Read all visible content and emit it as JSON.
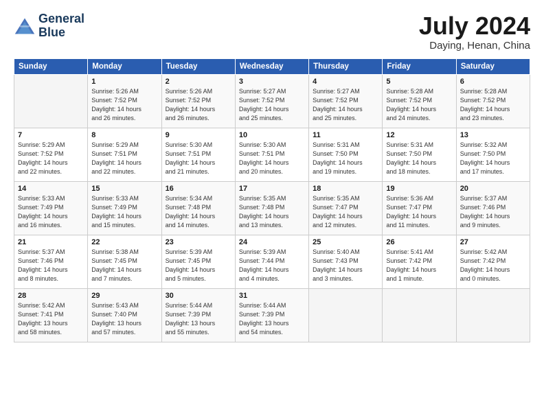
{
  "logo": {
    "line1": "General",
    "line2": "Blue"
  },
  "title": "July 2024",
  "subtitle": "Daying, Henan, China",
  "days_header": [
    "Sunday",
    "Monday",
    "Tuesday",
    "Wednesday",
    "Thursday",
    "Friday",
    "Saturday"
  ],
  "weeks": [
    [
      {
        "day": "",
        "info": ""
      },
      {
        "day": "1",
        "info": "Sunrise: 5:26 AM\nSunset: 7:52 PM\nDaylight: 14 hours\nand 26 minutes."
      },
      {
        "day": "2",
        "info": "Sunrise: 5:26 AM\nSunset: 7:52 PM\nDaylight: 14 hours\nand 26 minutes."
      },
      {
        "day": "3",
        "info": "Sunrise: 5:27 AM\nSunset: 7:52 PM\nDaylight: 14 hours\nand 25 minutes."
      },
      {
        "day": "4",
        "info": "Sunrise: 5:27 AM\nSunset: 7:52 PM\nDaylight: 14 hours\nand 25 minutes."
      },
      {
        "day": "5",
        "info": "Sunrise: 5:28 AM\nSunset: 7:52 PM\nDaylight: 14 hours\nand 24 minutes."
      },
      {
        "day": "6",
        "info": "Sunrise: 5:28 AM\nSunset: 7:52 PM\nDaylight: 14 hours\nand 23 minutes."
      }
    ],
    [
      {
        "day": "7",
        "info": "Sunrise: 5:29 AM\nSunset: 7:52 PM\nDaylight: 14 hours\nand 22 minutes."
      },
      {
        "day": "8",
        "info": "Sunrise: 5:29 AM\nSunset: 7:51 PM\nDaylight: 14 hours\nand 22 minutes."
      },
      {
        "day": "9",
        "info": "Sunrise: 5:30 AM\nSunset: 7:51 PM\nDaylight: 14 hours\nand 21 minutes."
      },
      {
        "day": "10",
        "info": "Sunrise: 5:30 AM\nSunset: 7:51 PM\nDaylight: 14 hours\nand 20 minutes."
      },
      {
        "day": "11",
        "info": "Sunrise: 5:31 AM\nSunset: 7:50 PM\nDaylight: 14 hours\nand 19 minutes."
      },
      {
        "day": "12",
        "info": "Sunrise: 5:31 AM\nSunset: 7:50 PM\nDaylight: 14 hours\nand 18 minutes."
      },
      {
        "day": "13",
        "info": "Sunrise: 5:32 AM\nSunset: 7:50 PM\nDaylight: 14 hours\nand 17 minutes."
      }
    ],
    [
      {
        "day": "14",
        "info": "Sunrise: 5:33 AM\nSunset: 7:49 PM\nDaylight: 14 hours\nand 16 minutes."
      },
      {
        "day": "15",
        "info": "Sunrise: 5:33 AM\nSunset: 7:49 PM\nDaylight: 14 hours\nand 15 minutes."
      },
      {
        "day": "16",
        "info": "Sunrise: 5:34 AM\nSunset: 7:48 PM\nDaylight: 14 hours\nand 14 minutes."
      },
      {
        "day": "17",
        "info": "Sunrise: 5:35 AM\nSunset: 7:48 PM\nDaylight: 14 hours\nand 13 minutes."
      },
      {
        "day": "18",
        "info": "Sunrise: 5:35 AM\nSunset: 7:47 PM\nDaylight: 14 hours\nand 12 minutes."
      },
      {
        "day": "19",
        "info": "Sunrise: 5:36 AM\nSunset: 7:47 PM\nDaylight: 14 hours\nand 11 minutes."
      },
      {
        "day": "20",
        "info": "Sunrise: 5:37 AM\nSunset: 7:46 PM\nDaylight: 14 hours\nand 9 minutes."
      }
    ],
    [
      {
        "day": "21",
        "info": "Sunrise: 5:37 AM\nSunset: 7:46 PM\nDaylight: 14 hours\nand 8 minutes."
      },
      {
        "day": "22",
        "info": "Sunrise: 5:38 AM\nSunset: 7:45 PM\nDaylight: 14 hours\nand 7 minutes."
      },
      {
        "day": "23",
        "info": "Sunrise: 5:39 AM\nSunset: 7:45 PM\nDaylight: 14 hours\nand 5 minutes."
      },
      {
        "day": "24",
        "info": "Sunrise: 5:39 AM\nSunset: 7:44 PM\nDaylight: 14 hours\nand 4 minutes."
      },
      {
        "day": "25",
        "info": "Sunrise: 5:40 AM\nSunset: 7:43 PM\nDaylight: 14 hours\nand 3 minutes."
      },
      {
        "day": "26",
        "info": "Sunrise: 5:41 AM\nSunset: 7:42 PM\nDaylight: 14 hours\nand 1 minute."
      },
      {
        "day": "27",
        "info": "Sunrise: 5:42 AM\nSunset: 7:42 PM\nDaylight: 14 hours\nand 0 minutes."
      }
    ],
    [
      {
        "day": "28",
        "info": "Sunrise: 5:42 AM\nSunset: 7:41 PM\nDaylight: 13 hours\nand 58 minutes."
      },
      {
        "day": "29",
        "info": "Sunrise: 5:43 AM\nSunset: 7:40 PM\nDaylight: 13 hours\nand 57 minutes."
      },
      {
        "day": "30",
        "info": "Sunrise: 5:44 AM\nSunset: 7:39 PM\nDaylight: 13 hours\nand 55 minutes."
      },
      {
        "day": "31",
        "info": "Sunrise: 5:44 AM\nSunset: 7:39 PM\nDaylight: 13 hours\nand 54 minutes."
      },
      {
        "day": "",
        "info": ""
      },
      {
        "day": "",
        "info": ""
      },
      {
        "day": "",
        "info": ""
      }
    ]
  ]
}
